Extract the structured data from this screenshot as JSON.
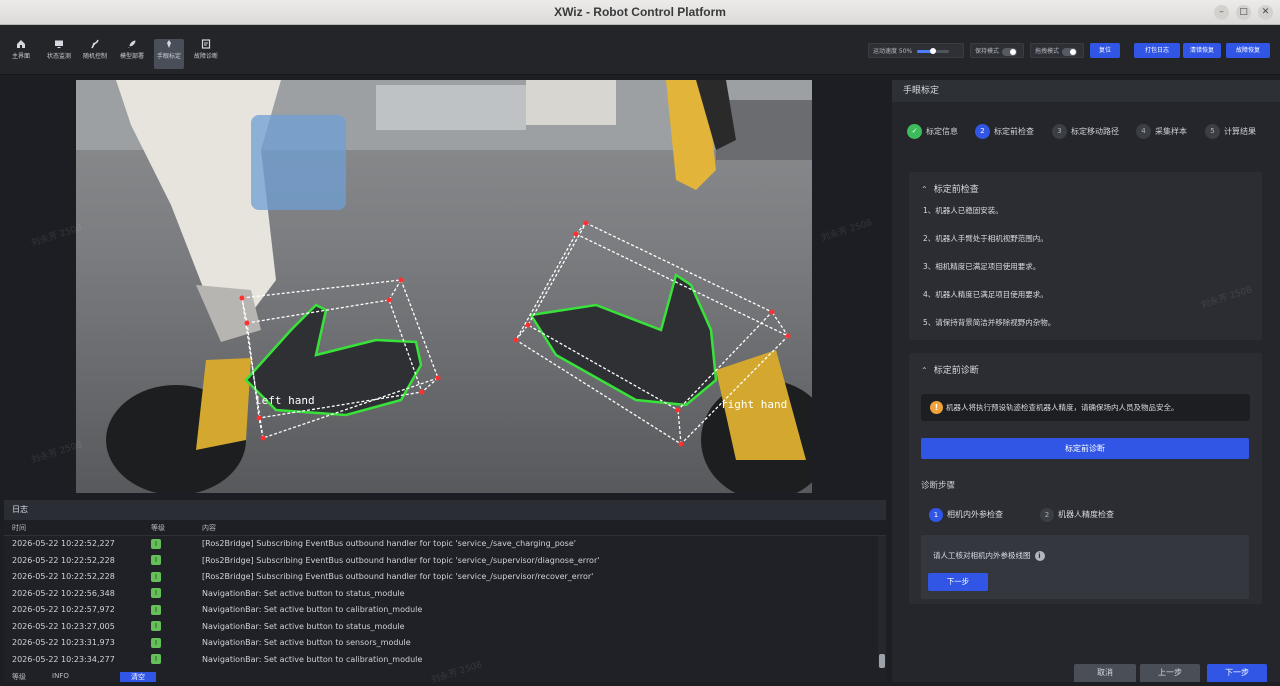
{
  "window": {
    "title": "XWiz - Robot Control Platform",
    "minimize": "–",
    "maximize": "□",
    "close": "✕"
  },
  "toolbar": {
    "nav": [
      {
        "label": "主界面",
        "icon": "home-icon"
      },
      {
        "label": "状态监测",
        "icon": "monitor-icon"
      },
      {
        "label": "随机控制",
        "icon": "arm-icon"
      },
      {
        "label": "模型部署",
        "icon": "rocket-icon"
      },
      {
        "label": "手眼标定",
        "icon": "calibrate-icon"
      },
      {
        "label": "故障诊断",
        "icon": "diagnose-icon"
      }
    ],
    "active_index": 4,
    "speed_label": "运动速度 50%",
    "speed_value": 0.5,
    "hold_label": "保持模式",
    "drag_label": "拖拽模式",
    "reset_label": "复位",
    "open_log_label": "打包日志",
    "clear_error_label": "清错恢复",
    "fault_label": "故障恢复"
  },
  "camera": {
    "left_hand_label": "left hand",
    "right_hand_label": "right hand"
  },
  "log": {
    "title": "日志",
    "columns": {
      "time": "时间",
      "level": "等级",
      "content": "内容"
    },
    "rows": [
      {
        "time": "2026-05-22 10:22:52,227",
        "level": "I",
        "msg": "[Ros2Bridge] Subscribing EventBus outbound handler for topic 'service_/save_charging_pose'"
      },
      {
        "time": "2026-05-22 10:22:52,228",
        "level": "I",
        "msg": "[Ros2Bridge] Subscribing EventBus outbound handler for topic 'service_/supervisor/diagnose_error'"
      },
      {
        "time": "2026-05-22 10:22:52,228",
        "level": "I",
        "msg": "[Ros2Bridge] Subscribing EventBus outbound handler for topic 'service_/supervisor/recover_error'"
      },
      {
        "time": "2026-05-22 10:22:56,348",
        "level": "I",
        "msg": "NavigationBar: Set active button to status_module"
      },
      {
        "time": "2026-05-22 10:22:57,972",
        "level": "I",
        "msg": "NavigationBar: Set active button to calibration_module"
      },
      {
        "time": "2026-05-22 10:23:27,005",
        "level": "I",
        "msg": "NavigationBar: Set active button to status_module"
      },
      {
        "time": "2026-05-22 10:23:31,973",
        "level": "I",
        "msg": "NavigationBar: Set active button to sensors_module"
      },
      {
        "time": "2026-05-22 10:23:34,277",
        "level": "I",
        "msg": "NavigationBar: Set active button to calibration_module"
      }
    ],
    "footer_level_label": "等级",
    "footer_level_value": "INFO",
    "footer_clear": "清空"
  },
  "calib": {
    "title": "手眼标定",
    "steps": [
      {
        "num": "✓",
        "label": "标定信息",
        "state": "done"
      },
      {
        "num": "2",
        "label": "标定前检查",
        "state": "current"
      },
      {
        "num": "3",
        "label": "标定移动路径",
        "state": "todo"
      },
      {
        "num": "4",
        "label": "采集样本",
        "state": "todo"
      },
      {
        "num": "5",
        "label": "计算结果",
        "state": "todo"
      }
    ],
    "precheck": {
      "title": "标定前检查",
      "items": [
        "1、机器人已稳固安装。",
        "2、机器人手臂处于相机视野范围内。",
        "3、相机精度已满足项目使用要求。",
        "4、机器人精度已满足项目使用要求。",
        "5、请保持背景简洁并移除视野内杂物。"
      ]
    },
    "diagnose": {
      "title": "标定前诊断",
      "warning": "机器人将执行预设轨迹检查机器人精度，请确保场内人员及物品安全。",
      "run_button": "标定前诊断",
      "steps_title": "诊断步骤",
      "steps": [
        {
          "num": "1",
          "label": "相机内外参检查",
          "state": "current"
        },
        {
          "num": "2",
          "label": "机器人精度检查",
          "state": "todo"
        }
      ],
      "instruction": "请人工核对相机内外参极线图",
      "next_button": "下一步"
    },
    "footer": {
      "cancel": "取消",
      "prev": "上一步",
      "next": "下一步"
    }
  },
  "watermark": "刘永芳 2508"
}
